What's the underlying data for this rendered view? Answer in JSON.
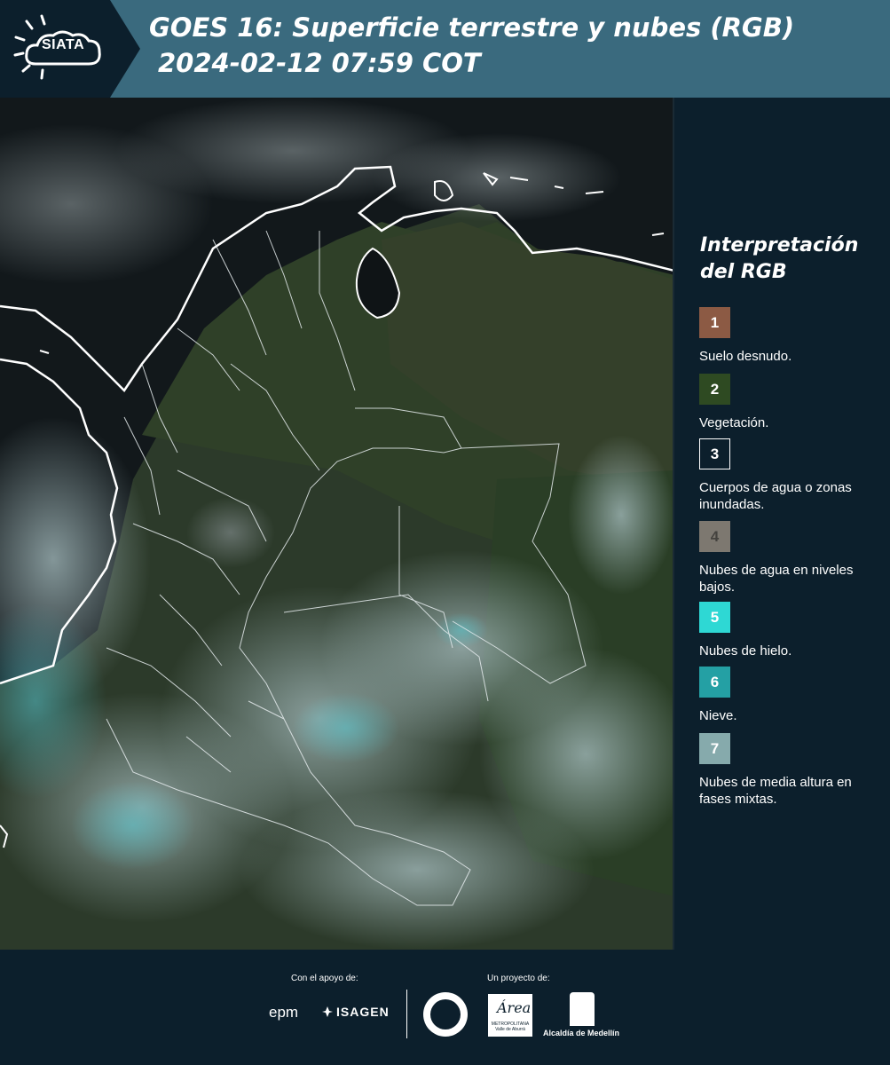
{
  "header": {
    "logo_text": "SIATA",
    "title_line1": "GOES 16: Superficie terrestre y nubes (RGB)",
    "title_line2": "2024-02-12 07:59 COT"
  },
  "legend": {
    "title": "Interpretación del RGB",
    "items": [
      {
        "number": "1",
        "label": "Suelo desnudo.",
        "color": "#8c5a44"
      },
      {
        "number": "2",
        "label": "Vegetación.",
        "color": "#2e4a22"
      },
      {
        "number": "3",
        "label": "Cuerpos de agua o zonas inundadas.",
        "color": "#0c1f2c"
      },
      {
        "number": "4",
        "label": "Nubes de agua en niveles bajos.",
        "color": "#7d7870"
      },
      {
        "number": "5",
        "label": "Nubes de hielo.",
        "color": "#2ed8d4"
      },
      {
        "number": "6",
        "label": "Nieve.",
        "color": "#24a0a4"
      },
      {
        "number": "7",
        "label": "Nubes de media altura en fases mixtas.",
        "color": "#86aaac"
      }
    ]
  },
  "footer": {
    "support_label": "Con el apoyo de:",
    "project_label": "Un proyecto de:",
    "sponsors": [
      "epm",
      "ISAGEN"
    ],
    "area_word": "Área",
    "area_subtitle": "METROPOLITANA Valle de Aburrá",
    "alcaldia_label": "Alcaldía de Medellín"
  },
  "colors": {
    "header_bg": "#3a6a7e",
    "panel_bg": "#0c1f2c"
  }
}
